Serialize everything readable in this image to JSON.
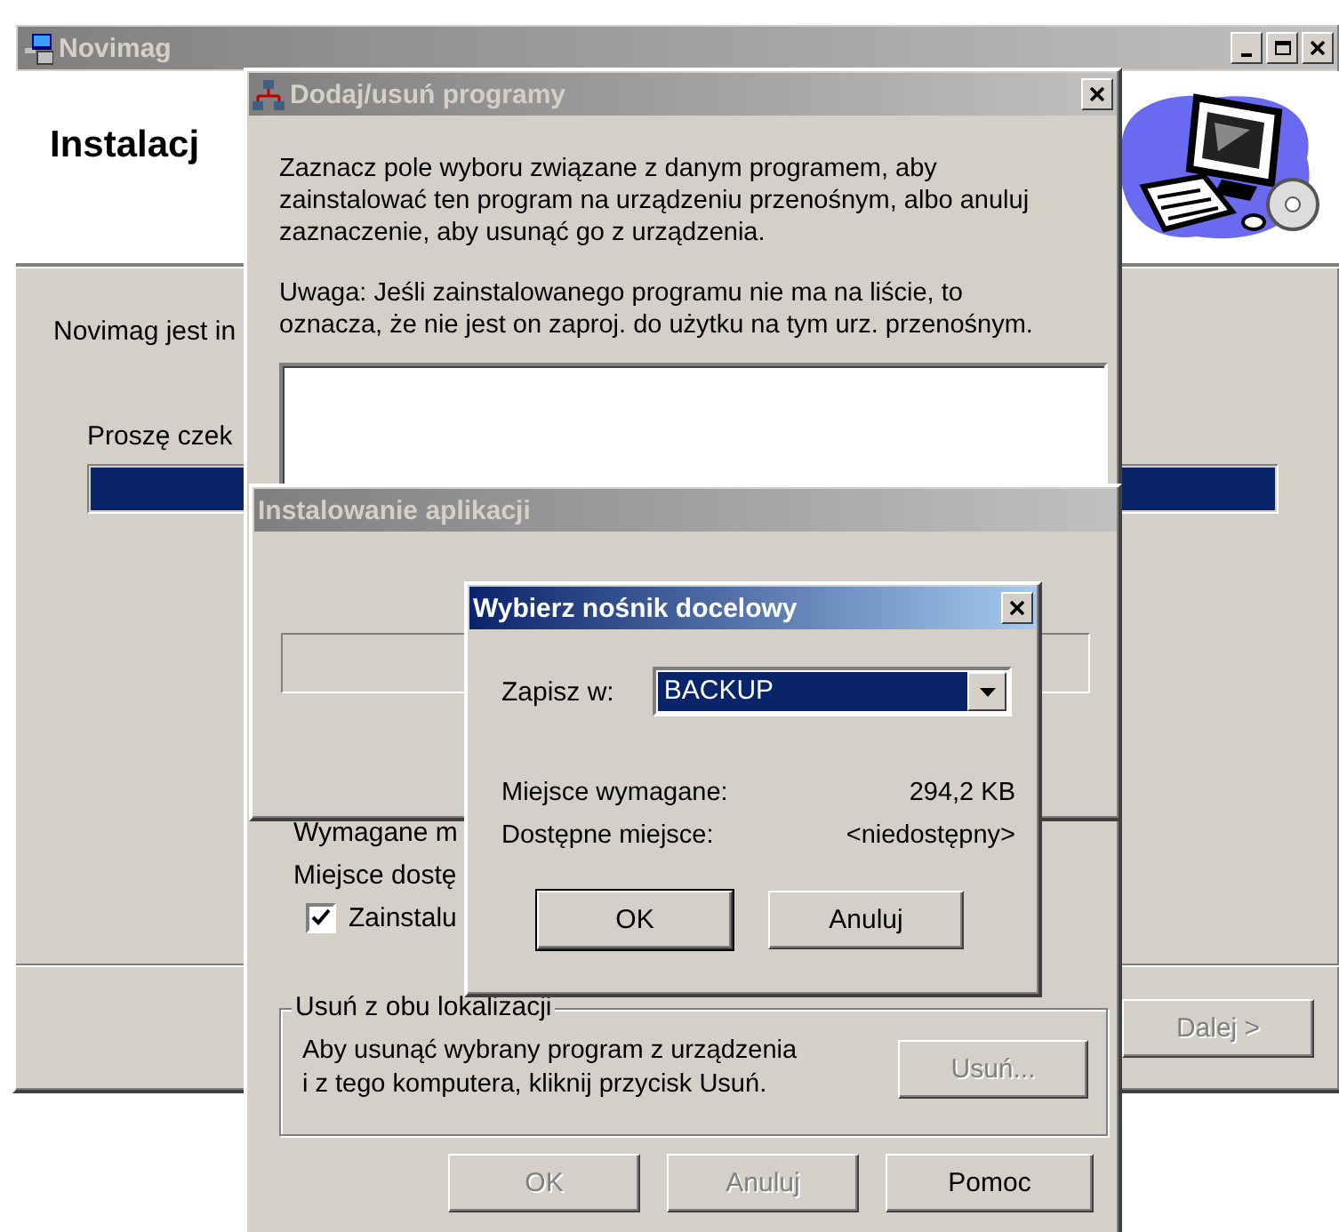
{
  "windows": [
    {
      "kind": "main",
      "title": "Novimag",
      "active": false,
      "header_title": "Instalacj",
      "message": "Novimag jest in",
      "progress_label": "Proszę czek",
      "progress": {
        "level": 1
      },
      "buttons": [
        {
          "label": "Dalej >",
          "disabled": true,
          "default": false
        }
      ]
    },
    {
      "kind": "programs",
      "title": "Dodaj/usuń programy",
      "active": false,
      "paragraphs": [
        "Zaznacz pole wyboru związane z danym programem, aby\nzainstalować ten program na urządzeniu przenośnym, albo anuluj\nzaznaczenie, aby usunąć go z urządzenia.",
        "Uwaga: Jeśli zainstalowanego programu nie ma na liście, to\noznacza, że nie jest on zaproj. do użytku na tym urz. przenośnym."
      ],
      "info_lines": [
        "Wymagane m",
        "Miejsce dostę"
      ],
      "checkbox": {
        "label": "Zainstalu",
        "checked": true
      },
      "group": {
        "title": "Usuń z obu lokalizacji",
        "text": "Aby usunąć wybrany program z urządzenia\ni z tego komputera, kliknij przycisk Usuń.",
        "button": {
          "label": "Usuń...",
          "disabled": true,
          "default": false
        }
      },
      "buttons": [
        {
          "label": "OK",
          "disabled": true,
          "default": false
        },
        {
          "label": "Anuluj",
          "disabled": true,
          "default": false
        },
        {
          "label": "Pomoc",
          "disabled": false,
          "default": false
        }
      ]
    },
    {
      "kind": "installing",
      "title": "Instalowanie aplikacji",
      "active": false,
      "progress": {
        "level": 0
      }
    },
    {
      "kind": "target",
      "title": "Wybierz nośnik docelowy",
      "active": true,
      "save_in": {
        "label": "Zapisz w:",
        "value": "BACKUP"
      },
      "rows": [
        {
          "label": "Miejsce wymagane:",
          "value": "294,2 KB"
        },
        {
          "label": "Dostępne miejsce:",
          "value": "<niedostępny>"
        }
      ],
      "buttons": [
        {
          "label": "OK",
          "disabled": false,
          "default": true
        },
        {
          "label": "Anuluj",
          "disabled": false,
          "default": false
        }
      ]
    }
  ]
}
